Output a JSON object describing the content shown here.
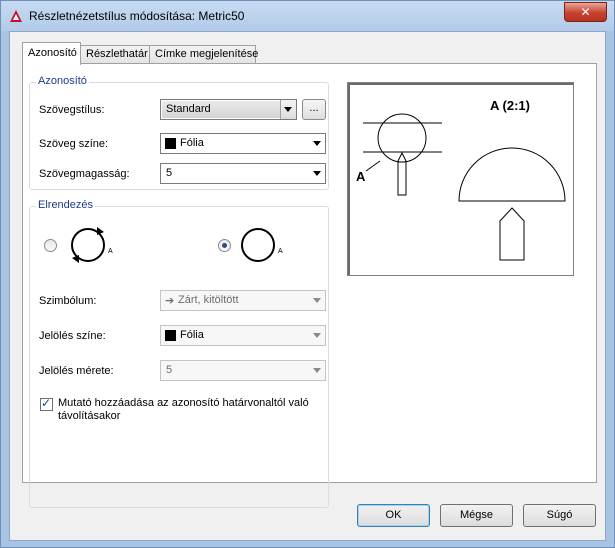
{
  "window": {
    "title": "Részletnézetstílus módosítása: Metric50",
    "close_label": "✕"
  },
  "tabs": [
    {
      "label": "Azonosító"
    },
    {
      "label": "Részlethatár"
    },
    {
      "label": "Címke megjelenítése"
    }
  ],
  "identifier_group": {
    "title": "Azonosító",
    "text_style_label": "Szövegstílus:",
    "text_style_value": "Standard",
    "browse_label": "...",
    "text_color_label": "Szöveg színe:",
    "text_color_value": "Fólia",
    "text_height_label": "Szövegmagasság:",
    "text_height_value": "5"
  },
  "layout_group": {
    "title": "Elrendezés",
    "option_letter_left": "A",
    "option_letter_right": "A",
    "selected_option": "right",
    "symbol_label": "Szimbólum:",
    "symbol_value": "Zárt, kitöltött",
    "arrow_color_label": "Jelölés színe:",
    "arrow_color_value": "Fólia",
    "arrow_size_label": "Jelölés mérete:",
    "arrow_size_value": "5",
    "checkbox_label": "Mutató hozzáadása az azonosító határvonaltól való távolításakor",
    "checkbox_checked": true
  },
  "preview": {
    "detail_label": "A (2:1)",
    "callout_letter": "A"
  },
  "buttons": {
    "ok": "OK",
    "cancel": "Mégse",
    "help": "Súgó"
  },
  "colors": {
    "accent": "#1e3a8a",
    "close": "#c7432f",
    "app_icon": "#c8102e"
  }
}
